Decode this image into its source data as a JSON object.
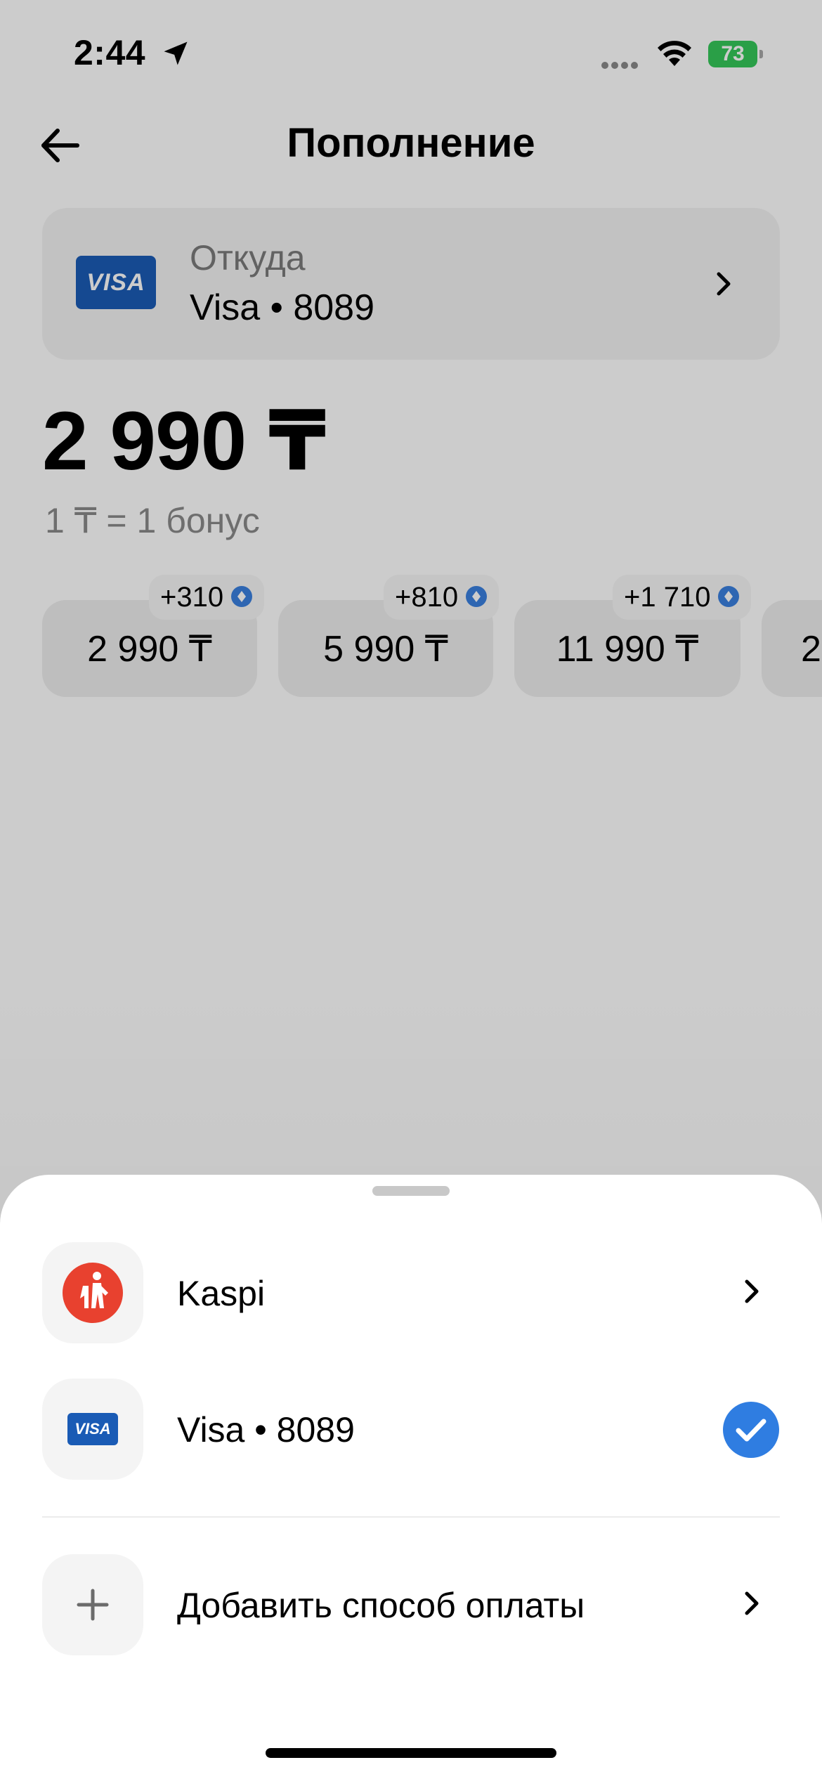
{
  "status_bar": {
    "time": "2:44",
    "battery": "73"
  },
  "header": {
    "title": "Пополнение"
  },
  "source": {
    "label": "Откуда",
    "value": "Visa • 8089",
    "logo_text": "VISA"
  },
  "amount": {
    "value": "2 990 ₸",
    "rate": "1 ₸ = 1 бонус"
  },
  "presets": [
    {
      "amount": "2 990 ₸",
      "bonus": "+310"
    },
    {
      "amount": "5 990 ₸",
      "bonus": "+810"
    },
    {
      "amount": "11 990 ₸",
      "bonus": "+1 710"
    },
    {
      "amount": "2",
      "bonus": ""
    }
  ],
  "sheet": {
    "methods": [
      {
        "label": "Kaspi",
        "icon": "kaspi-logo",
        "selected": false
      },
      {
        "label": "Visa • 8089",
        "icon": "visa-logo",
        "logo_text": "VISA",
        "selected": true
      }
    ],
    "add_method_label": "Добавить способ оплаты"
  },
  "colors": {
    "accent": "#2f7de1",
    "visa": "#1a5bb5",
    "kaspi": "#e8412f",
    "battery": "#34c759"
  }
}
